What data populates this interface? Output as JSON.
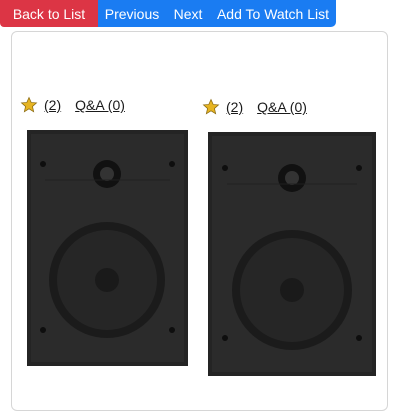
{
  "toolbar": {
    "back_label": "Back to List",
    "previous_label": "Previous",
    "next_label": "Next",
    "watch_label": "Add To Watch List"
  },
  "products": [
    {
      "rating_count": "(2)",
      "qa_label": "Q&A (0)",
      "image_icon": "speaker-icon"
    },
    {
      "rating_count": "(2)",
      "qa_label": "Q&A (0)",
      "image_icon": "speaker-icon"
    }
  ],
  "colors": {
    "back_button": "#dc3545",
    "nav_button": "#1a7cf2",
    "star": "#e6b422"
  }
}
